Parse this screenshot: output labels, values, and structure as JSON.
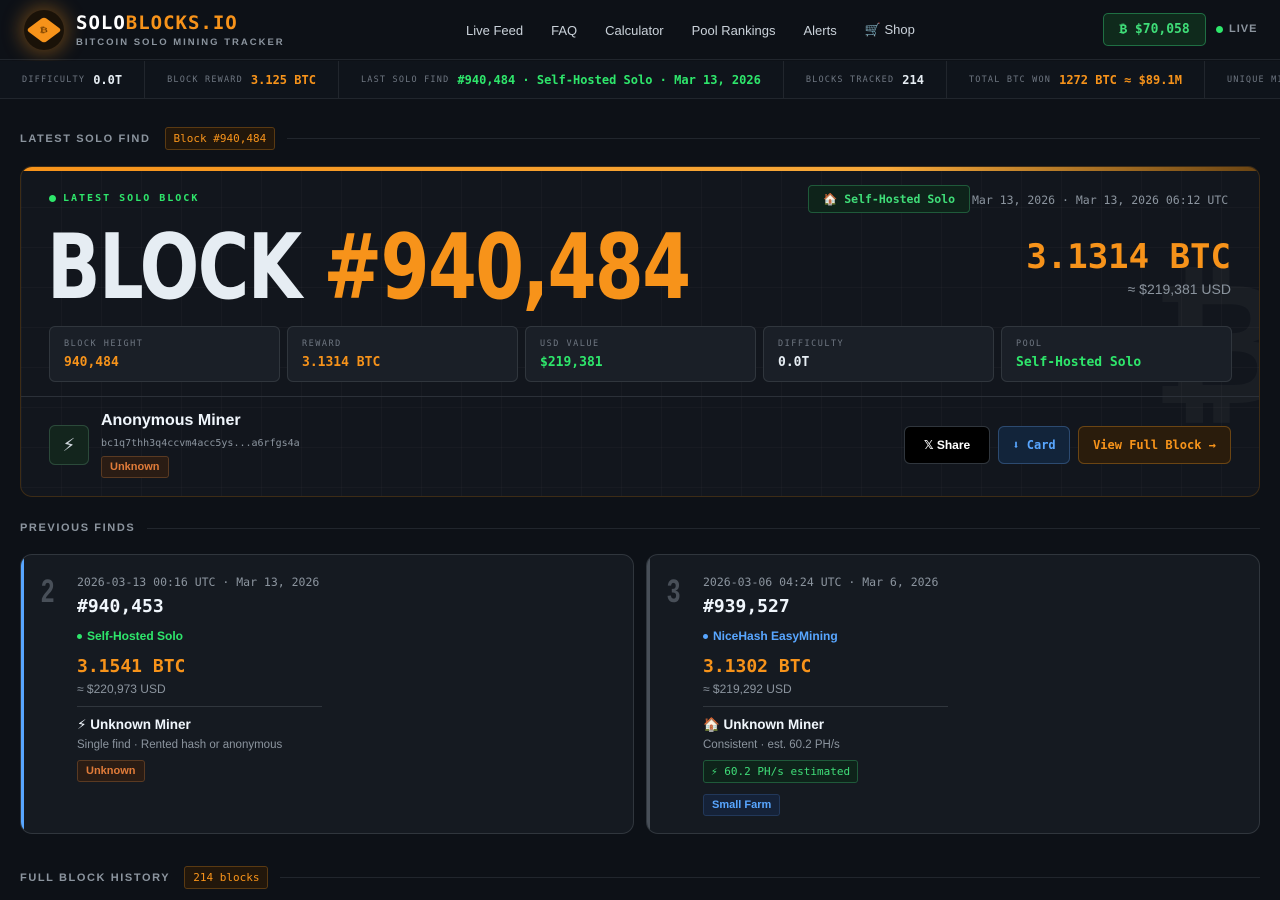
{
  "header": {
    "logo_solo": "SOLO",
    "logo_blocks": "BLOCKS.IO",
    "logo_subtitle": "BITCOIN SOLO MINING TRACKER",
    "logo_glyph": "₿",
    "nav": [
      "Live Feed",
      "FAQ",
      "Calculator",
      "Pool Rankings",
      "Alerts",
      "🛒 Shop"
    ],
    "price": "₿ $70,058",
    "live_label": "LIVE"
  },
  "ticker": [
    {
      "key": "DIFFICULTY",
      "value": "0.0T",
      "color": "#e6edf3"
    },
    {
      "key": "BLOCK REWARD",
      "value": "3.125 BTC",
      "color": "#f7931a"
    },
    {
      "key": "LAST SOLO FIND",
      "value": "#940,484 · Self-Hosted Solo · Mar 13, 2026",
      "color": "#2ee66b"
    },
    {
      "key": "BLOCKS TRACKED",
      "value": "214",
      "color": "#e6edf3"
    },
    {
      "key": "TOTAL BTC WON",
      "value": "1272 BTC ≈ $89.1M",
      "color": "#f7931a"
    },
    {
      "key": "UNIQUE MINERS",
      "value": "",
      "color": "#e6edf3"
    }
  ],
  "latest": {
    "section_title": "LATEST SOLO FIND",
    "section_tag": "Block #940,484",
    "label": "LATEST SOLO BLOCK",
    "pool_badge": "🏠 Self-Hosted Solo",
    "date": "Mar 13, 2026 · Mar 13, 2026 06:12 UTC",
    "block_word": "BLOCK",
    "block_number": "#940,484",
    "btc": "3.1314 BTC",
    "usd": "≈ $219,381 USD",
    "ghost_glyph": "₿",
    "stats": [
      {
        "key": "BLOCK HEIGHT",
        "value": "940,484",
        "color": "#f7931a"
      },
      {
        "key": "REWARD",
        "value": "3.1314 BTC",
        "color": "#f7931a"
      },
      {
        "key": "USD VALUE",
        "value": "$219,381",
        "color": "#2ee66b"
      },
      {
        "key": "DIFFICULTY",
        "value": "0.0T",
        "color": "#e6edf3"
      },
      {
        "key": "POOL",
        "value": "Self-Hosted Solo",
        "color": "#2ee66b"
      }
    ],
    "miner_icon": "⚡",
    "miner_name": "Anonymous Miner",
    "miner_address": "bc1q7thh3q4ccvm4acc5ys...a6rfgs4a",
    "miner_tag": "Unknown",
    "btn_share": "𝕏 Share",
    "btn_card": "⬇ Card",
    "btn_view": "View Full Block →"
  },
  "previous": {
    "section_title": "PREVIOUS FINDS",
    "cards": [
      {
        "rank": "2",
        "accent": "#58a6ff",
        "date": "2026-03-13 00:16 UTC · Mar 13, 2026",
        "number": "#940,453",
        "pool": "Self-Hosted Solo",
        "pool_color": "#2ee66b",
        "btc": "3.1541 BTC",
        "usd": "≈ $220,973 USD",
        "miner": "⚡ Unknown Miner",
        "desc": "Single find · Rented hash or anonymous",
        "hashrate": "",
        "tags": [
          "Unknown"
        ],
        "tag_types": [
          "unk"
        ]
      },
      {
        "rank": "3",
        "accent": "#484f58",
        "date": "2026-03-06 04:24 UTC · Mar 6, 2026",
        "number": "#939,527",
        "pool": "NiceHash EasyMining",
        "pool_color": "#58a6ff",
        "btc": "3.1302 BTC",
        "usd": "≈ $219,292 USD",
        "miner": "🏠 Unknown Miner",
        "desc": "Consistent · est. 60.2 PH/s",
        "hashrate": "⚡ 60.2 PH/s estimated",
        "tags": [
          "Small Farm"
        ],
        "tag_types": [
          "farm"
        ]
      }
    ]
  },
  "history": {
    "section_title": "FULL BLOCK HISTORY",
    "section_tag": "214 blocks"
  }
}
